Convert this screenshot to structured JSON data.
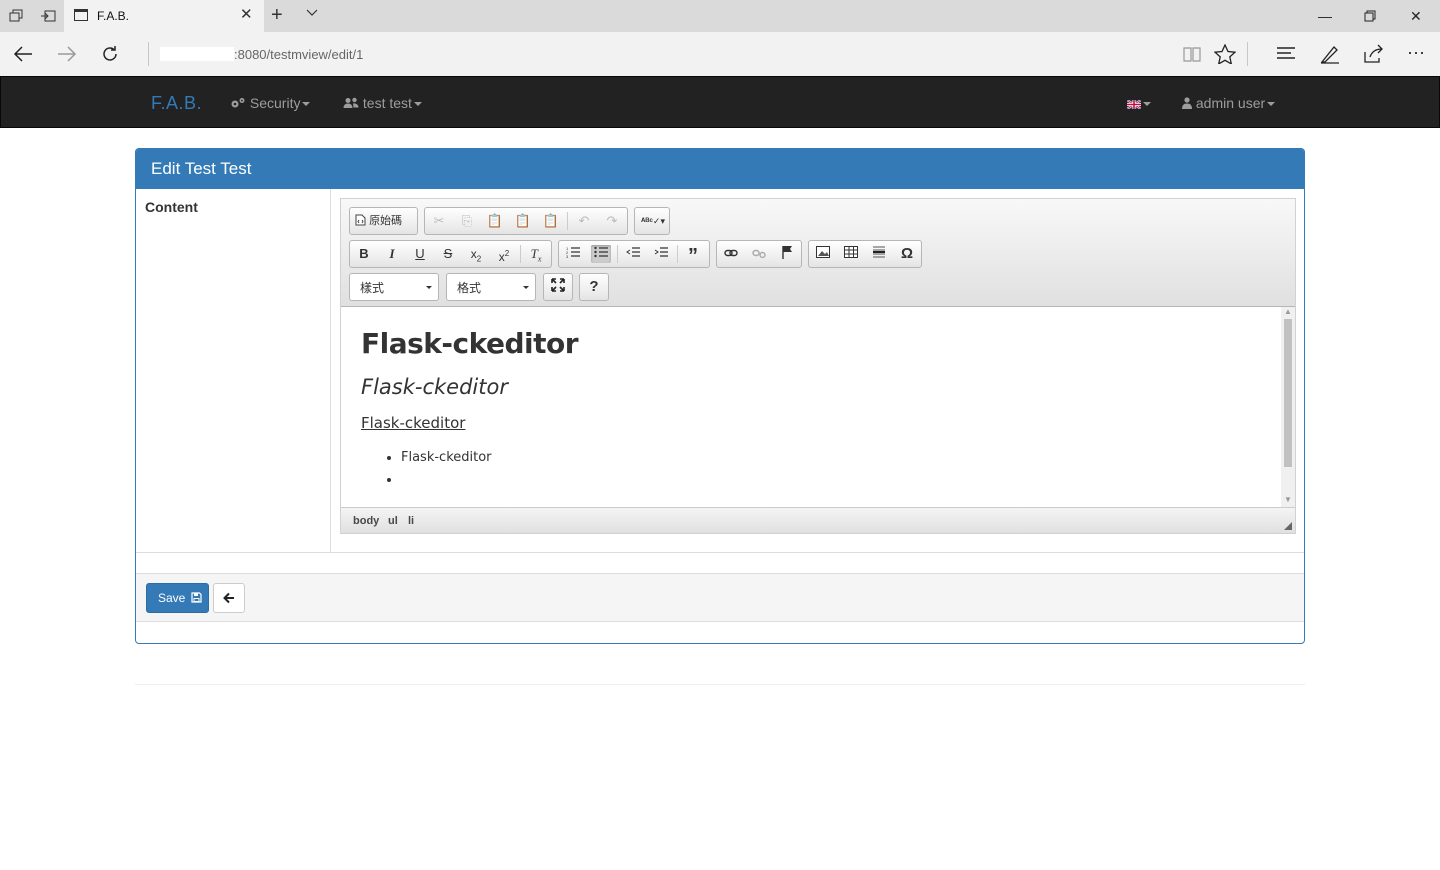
{
  "browser": {
    "tab_title": "F.A.B.",
    "address": ":8080/testmview/edit/1"
  },
  "navbar": {
    "brand": "F.A.B.",
    "menu_security": "Security",
    "menu_test": "test test",
    "user_menu": "admin user"
  },
  "panel": {
    "title": "Edit Test Test",
    "field_label": "Content"
  },
  "editor": {
    "source_label": "原始碼",
    "styles_combo": "樣式",
    "format_combo": "格式",
    "content": {
      "heading1": "Flask-ckeditor",
      "heading2": "Flask-ckeditor",
      "underlined": "Flask-ckeditor ",
      "list_items": [
        "Flask-ckeditor",
        ""
      ]
    },
    "path": [
      "body",
      "ul",
      "li"
    ]
  },
  "actions": {
    "save_label": "Save"
  },
  "colors": {
    "primary": "#337ab7",
    "navbar_bg": "#222222",
    "navbar_text": "#9d9d9d"
  }
}
